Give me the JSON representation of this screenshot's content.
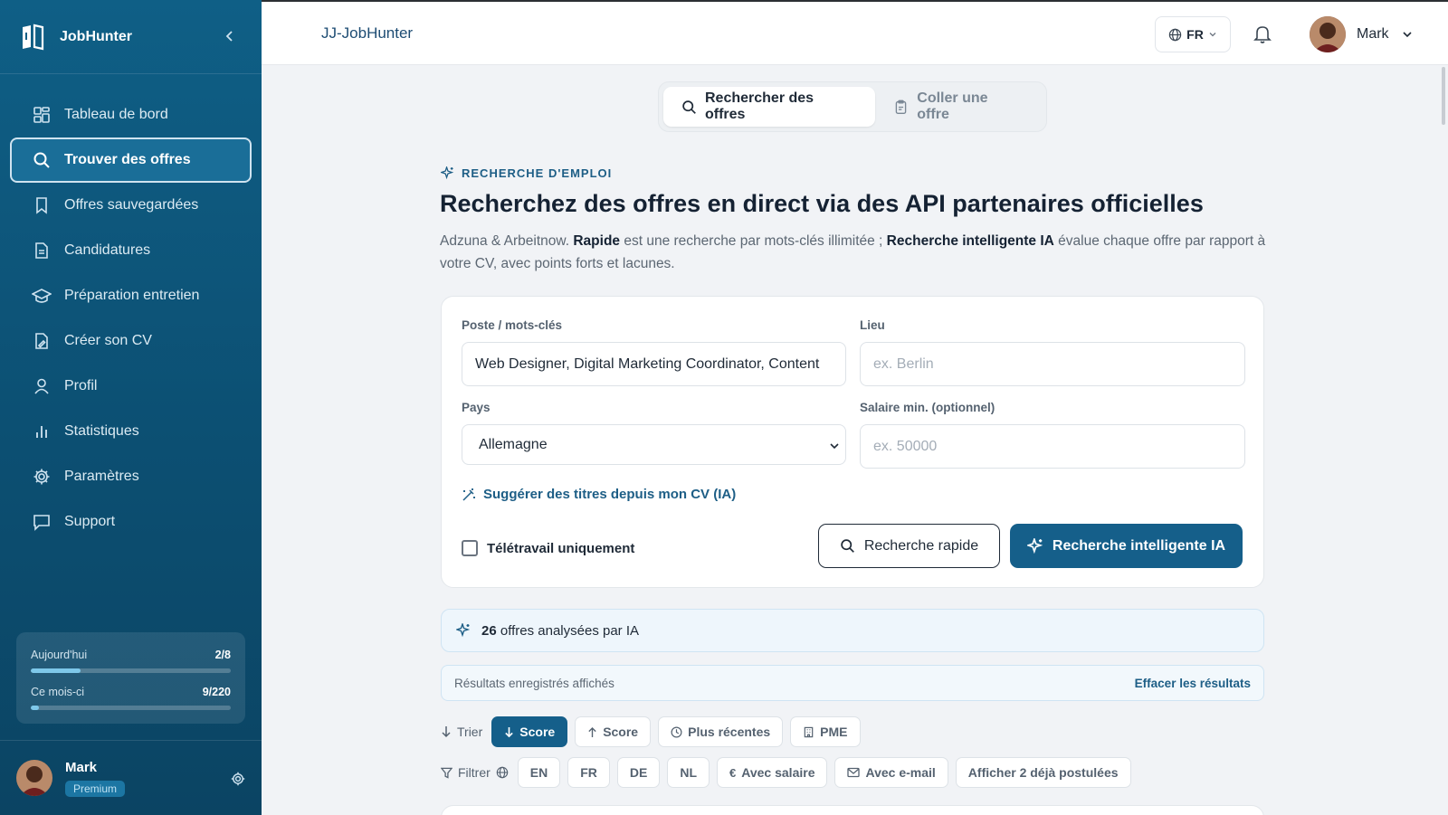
{
  "sidebar": {
    "brand": "JobHunter",
    "items": [
      {
        "label": "Tableau de bord",
        "icon": "dashboard-icon"
      },
      {
        "label": "Trouver des offres",
        "icon": "search-icon",
        "active": true
      },
      {
        "label": "Offres sauvegardées",
        "icon": "bookmark-icon"
      },
      {
        "label": "Candidatures",
        "icon": "document-icon"
      },
      {
        "label": "Préparation entretien",
        "icon": "graduation-cap-icon"
      },
      {
        "label": "Créer son CV",
        "icon": "file-edit-icon"
      },
      {
        "label": "Profil",
        "icon": "user-icon"
      },
      {
        "label": "Statistiques",
        "icon": "bar-chart-icon"
      },
      {
        "label": "Paramètres",
        "icon": "gear-icon"
      },
      {
        "label": "Support",
        "icon": "message-icon"
      }
    ],
    "usage": {
      "today_label": "Aujourd'hui",
      "today_value": "2/8",
      "today_fraction": 0.25,
      "month_label": "Ce mois-ci",
      "month_value": "9/220",
      "month_fraction": 0.04
    },
    "user": {
      "name": "Mark",
      "plan": "Premium"
    }
  },
  "topbar": {
    "title": "JJ-JobHunter",
    "language": "FR",
    "user_name": "Mark"
  },
  "tabs": [
    {
      "label": "Rechercher des offres",
      "active": true
    },
    {
      "label": "Coller une offre",
      "active": false
    }
  ],
  "hero": {
    "eyebrow": "RECHERCHE D'EMPLOI",
    "title": "Recherchez des offres en direct via des API partenaires officielles",
    "desc_1": "Adzuna & Arbeitnow. ",
    "desc_bold_1": "Rapide",
    "desc_2": " est une recherche par mots-clés illimitée ; ",
    "desc_bold_2": "Recherche intelligente IA",
    "desc_3": " évalue chaque offre par rapport à votre CV, avec points forts et lacunes."
  },
  "form": {
    "keywords_label": "Poste / mots-clés",
    "keywords_value": "Web Designer, Digital Marketing Coordinator, Content",
    "location_label": "Lieu",
    "location_placeholder": "ex. Berlin",
    "country_label": "Pays",
    "country_value": "Allemagne",
    "salary_label": "Salaire min. (optionnel)",
    "salary_placeholder": "ex. 50000",
    "suggest_label": "Suggérer des titres depuis mon CV (IA)",
    "remote_label": "Télétravail uniquement",
    "quick_button": "Recherche rapide",
    "ai_button": "Recherche intelligente IA"
  },
  "results": {
    "count": "26",
    "count_text": "offres analysées par IA",
    "saved_text": "Résultats enregistrés affichés",
    "clear_label": "Effacer les résultats"
  },
  "sort": {
    "label": "Trier",
    "options": [
      "Score",
      "Score",
      "Plus récentes",
      "PME"
    ]
  },
  "filter": {
    "label": "Filtrer",
    "options": [
      "EN",
      "FR",
      "DE",
      "NL",
      "Avec salaire",
      "Avec e-mail",
      "Afficher 2 déjà postulées"
    ]
  }
}
